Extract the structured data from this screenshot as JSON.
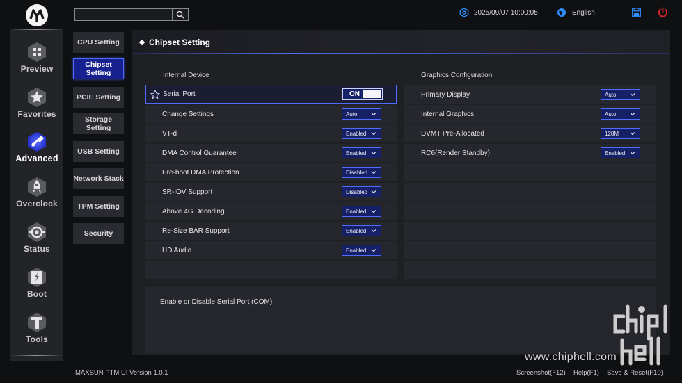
{
  "header": {
    "datetime": "2025/09/07 10:00:05",
    "language": "English"
  },
  "nav": {
    "items": [
      {
        "label": "Preview"
      },
      {
        "label": "Favorites"
      },
      {
        "label": "Advanced"
      },
      {
        "label": "Overclock"
      },
      {
        "label": "Status"
      },
      {
        "label": "Boot"
      },
      {
        "label": "Tools"
      }
    ],
    "active": "Advanced"
  },
  "submenu": {
    "items": [
      {
        "label": "CPU Setting"
      },
      {
        "label": "Chipset Setting"
      },
      {
        "label": "PCIE Setting"
      },
      {
        "label": "Storage Setting"
      },
      {
        "label": "USB Setting"
      },
      {
        "label": "Network Stack"
      },
      {
        "label": "TPM Setting"
      },
      {
        "label": "Security"
      }
    ],
    "active": "Chipset Setting"
  },
  "panel": {
    "title": "Chipset Setting",
    "left": {
      "heading": "Internal Device",
      "rows": [
        {
          "label": "Serial Port",
          "value": "ON"
        },
        {
          "label": "Change Settings",
          "value": "Auto"
        },
        {
          "label": "VT-d",
          "value": "Enabled"
        },
        {
          "label": "DMA Control Guarantee",
          "value": "Enabled"
        },
        {
          "label": "Pre-boot DMA Protection",
          "value": "Disabled"
        },
        {
          "label": "SR-IOV Support",
          "value": "Disabled"
        },
        {
          "label": "Above 4G Decoding",
          "value": "Enabled"
        },
        {
          "label": "Re-Size BAR Support",
          "value": "Enabled"
        },
        {
          "label": "HD Audio",
          "value": "Enabled"
        }
      ]
    },
    "right": {
      "heading": "Graphics Configuration",
      "rows": [
        {
          "label": "Primary Display",
          "value": "Auto"
        },
        {
          "label": "Internal Graphics",
          "value": "Auto"
        },
        {
          "label": "DVMT Pre-Allocated",
          "value": "128M"
        },
        {
          "label": "RC6(Render Standby)",
          "value": "Enabled"
        }
      ]
    },
    "description": "Enable or Disable Serial Port (COM)"
  },
  "footer": {
    "version": "MAXSUN PTM UI Version 1.0.1",
    "screenshot": "Screenshot(F12)",
    "help": "Help(F1)",
    "save_reset": "Save & Reset(F10)"
  },
  "watermark": {
    "site": "www.chiphell.com"
  },
  "colors": {
    "accent_blue": "#4f6cff",
    "active_bg": "#16208f",
    "power_red": "#e0262b",
    "icon_blue": "#2f8fff"
  }
}
